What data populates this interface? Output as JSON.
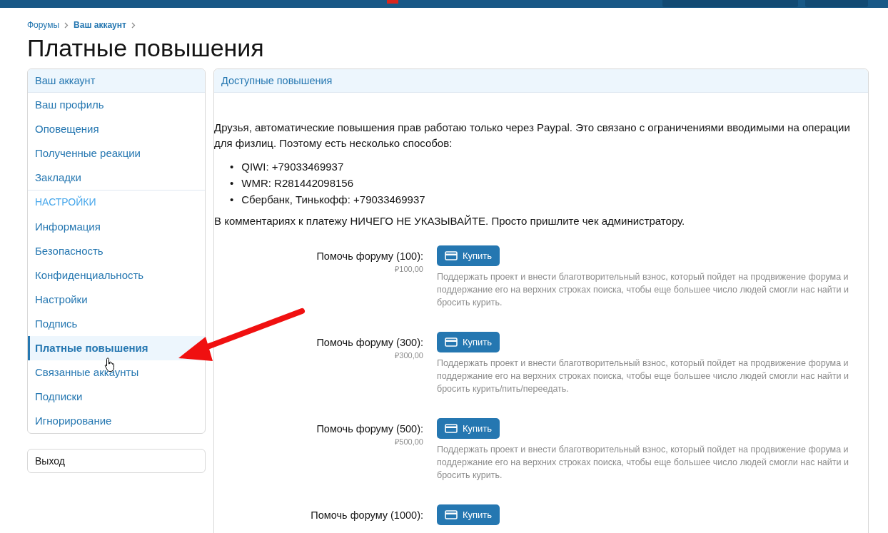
{
  "breadcrumbs": [
    {
      "label": "Форумы",
      "current": false
    },
    {
      "label": "Ваш аккаунт",
      "current": true
    }
  ],
  "page_title": "Платные повышения",
  "sidebar": {
    "title": "Ваш аккаунт",
    "items": [
      {
        "kind": "link",
        "label": "Ваш профиль",
        "selected": false
      },
      {
        "kind": "link",
        "label": "Оповещения",
        "selected": false
      },
      {
        "kind": "link",
        "label": "Полученные реакции",
        "selected": false
      },
      {
        "kind": "link",
        "label": "Закладки",
        "selected": false
      },
      {
        "kind": "section",
        "label": "НАСТРОЙКИ"
      },
      {
        "kind": "link",
        "label": "Информация",
        "selected": false
      },
      {
        "kind": "link",
        "label": "Безопасность",
        "selected": false
      },
      {
        "kind": "link",
        "label": "Конфиденциальность",
        "selected": false
      },
      {
        "kind": "link",
        "label": "Настройки",
        "selected": false
      },
      {
        "kind": "link",
        "label": "Подпись",
        "selected": false
      },
      {
        "kind": "link",
        "label": "Платные повышения",
        "selected": true
      },
      {
        "kind": "link",
        "label": "Связанные аккаунты",
        "selected": false
      },
      {
        "kind": "link",
        "label": "Подписки",
        "selected": false
      },
      {
        "kind": "link",
        "label": "Игнорирование",
        "selected": false
      }
    ],
    "logout": "Выход"
  },
  "main": {
    "title": "Доступные повышения",
    "intro": "Друзья, автоматические повышения прав работаю только через Paypal. Это связано с ограничениями вводимыми на операции для физлиц. Поэтому есть несколько способов:",
    "methods": [
      {
        "marker": "•",
        "text": "QIWI: +79033469937"
      },
      {
        "marker": "•",
        "text": "WMR: R281442098156"
      },
      {
        "marker": "•",
        "text": "Сбербанк, Тинькофф: +79033469937"
      }
    ],
    "note": "В комментариях к платежу НИЧЕГО НЕ УКАЗЫВАЙТЕ. Просто пришлите чек администратору.",
    "upgrades": [
      {
        "title": "Помочь форуму (100):",
        "price": "₽100,00",
        "button": "Купить",
        "description": "Поддержать проект и внести благотворительный взнос, который пойдет на продвижение форума и поддержание его на верхних строках поиска, чтобы еще большее число людей смогли нас найти и бросить курить."
      },
      {
        "title": "Помочь форуму (300):",
        "price": "₽300,00",
        "button": "Купить",
        "description": "Поддержать проект и внести благотворительный взнос, который пойдет на продвижение форума и поддержание его на верхних строках поиска, чтобы еще большее число людей смогли нас найти и бросить курить/пить/переедать."
      },
      {
        "title": "Помочь форуму (500):",
        "price": "₽500,00",
        "button": "Купить",
        "description": "Поддержать проект и внести благотворительный взнос, который пойдет на продвижение форума и поддержание его на верхних строках поиска, чтобы еще большее число людей смогли нас найти и бросить курить."
      },
      {
        "title": "Помочь форуму (1000):",
        "button": "Купить"
      }
    ]
  }
}
